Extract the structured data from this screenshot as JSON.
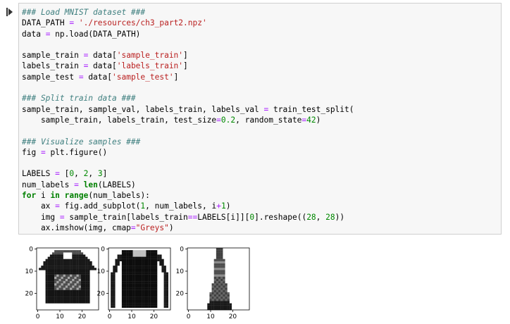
{
  "cell": {
    "code_lines": [
      [
        {
          "t": "### Load MNIST dataset ###",
          "c": "comment"
        }
      ],
      [
        {
          "t": "DATA_PATH ",
          "c": "plain"
        },
        {
          "t": "=",
          "c": "op"
        },
        {
          "t": " ",
          "c": "plain"
        },
        {
          "t": "'./resources/ch3_part2.npz'",
          "c": "string"
        }
      ],
      [
        {
          "t": "data ",
          "c": "plain"
        },
        {
          "t": "=",
          "c": "op"
        },
        {
          "t": " np.load(DATA_PATH)",
          "c": "plain"
        }
      ],
      [],
      [
        {
          "t": "sample_train ",
          "c": "plain"
        },
        {
          "t": "=",
          "c": "op"
        },
        {
          "t": " data[",
          "c": "plain"
        },
        {
          "t": "'sample_train'",
          "c": "string"
        },
        {
          "t": "]",
          "c": "plain"
        }
      ],
      [
        {
          "t": "labels_train ",
          "c": "plain"
        },
        {
          "t": "=",
          "c": "op"
        },
        {
          "t": " data[",
          "c": "plain"
        },
        {
          "t": "'labels_train'",
          "c": "string"
        },
        {
          "t": "]",
          "c": "plain"
        }
      ],
      [
        {
          "t": "sample_test ",
          "c": "plain"
        },
        {
          "t": "=",
          "c": "op"
        },
        {
          "t": " data[",
          "c": "plain"
        },
        {
          "t": "'sample_test'",
          "c": "string"
        },
        {
          "t": "]",
          "c": "plain"
        }
      ],
      [],
      [
        {
          "t": "### Split train data ###",
          "c": "comment"
        }
      ],
      [
        {
          "t": "sample_train, sample_val, labels_train, labels_val ",
          "c": "plain"
        },
        {
          "t": "=",
          "c": "op"
        },
        {
          "t": " train_test_split(",
          "c": "plain"
        }
      ],
      [
        {
          "t": "    sample_train, labels_train, test_size",
          "c": "plain"
        },
        {
          "t": "=",
          "c": "op"
        },
        {
          "t": "0.2",
          "c": "number"
        },
        {
          "t": ", random_state",
          "c": "plain"
        },
        {
          "t": "=",
          "c": "op"
        },
        {
          "t": "42",
          "c": "number"
        },
        {
          "t": ")",
          "c": "plain"
        }
      ],
      [],
      [
        {
          "t": "### Visualize samples ###",
          "c": "comment"
        }
      ],
      [
        {
          "t": "fig ",
          "c": "plain"
        },
        {
          "t": "=",
          "c": "op"
        },
        {
          "t": " plt.figure()",
          "c": "plain"
        }
      ],
      [],
      [
        {
          "t": "LABELS ",
          "c": "plain"
        },
        {
          "t": "=",
          "c": "op"
        },
        {
          "t": " [",
          "c": "plain"
        },
        {
          "t": "0",
          "c": "number"
        },
        {
          "t": ", ",
          "c": "plain"
        },
        {
          "t": "2",
          "c": "number"
        },
        {
          "t": ", ",
          "c": "plain"
        },
        {
          "t": "3",
          "c": "number"
        },
        {
          "t": "]",
          "c": "plain"
        }
      ],
      [
        {
          "t": "num_labels ",
          "c": "plain"
        },
        {
          "t": "=",
          "c": "op"
        },
        {
          "t": " ",
          "c": "plain"
        },
        {
          "t": "len",
          "c": "keyword"
        },
        {
          "t": "(LABELS)",
          "c": "plain"
        }
      ],
      [
        {
          "t": "for",
          "c": "keyword"
        },
        {
          "t": " i ",
          "c": "plain"
        },
        {
          "t": "in",
          "c": "keyword"
        },
        {
          "t": " ",
          "c": "plain"
        },
        {
          "t": "range",
          "c": "keyword"
        },
        {
          "t": "(num_labels):",
          "c": "plain"
        }
      ],
      [
        {
          "t": "    ax ",
          "c": "plain"
        },
        {
          "t": "=",
          "c": "op"
        },
        {
          "t": " fig.add_subplot(",
          "c": "plain"
        },
        {
          "t": "1",
          "c": "number"
        },
        {
          "t": ", num_labels, i",
          "c": "plain"
        },
        {
          "t": "+",
          "c": "op"
        },
        {
          "t": "1",
          "c": "number"
        },
        {
          "t": ")",
          "c": "plain"
        }
      ],
      [
        {
          "t": "    img ",
          "c": "plain"
        },
        {
          "t": "=",
          "c": "op"
        },
        {
          "t": " sample_train[labels_train",
          "c": "plain"
        },
        {
          "t": "==",
          "c": "op"
        },
        {
          "t": "LABELS[i]][",
          "c": "plain"
        },
        {
          "t": "0",
          "c": "number"
        },
        {
          "t": "].reshape((",
          "c": "plain"
        },
        {
          "t": "28",
          "c": "number"
        },
        {
          "t": ", ",
          "c": "plain"
        },
        {
          "t": "28",
          "c": "number"
        },
        {
          "t": "))",
          "c": "plain"
        }
      ],
      [
        {
          "t": "    ax.imshow(img, cmap",
          "c": "plain"
        },
        {
          "t": "=",
          "c": "op"
        },
        {
          "t": "\"Greys\"",
          "c": "string"
        },
        {
          "t": ")",
          "c": "plain"
        }
      ]
    ]
  },
  "colors": {
    "comment": "#408080",
    "string": "#ba2121",
    "keyword": "#008000",
    "number": "#008800",
    "op": "#aa22ff",
    "cell_background": "#f7f7f7",
    "cell_border": "#cfcfcf"
  },
  "output": {
    "panels": [
      {
        "label_value": 0,
        "garment": "t-shirt",
        "x_ticks": [
          "0",
          "10",
          "20"
        ],
        "y_ticks": [
          "0",
          "10",
          "20"
        ]
      },
      {
        "label_value": 2,
        "garment": "long-sleeve-top",
        "x_ticks": [
          "0",
          "10",
          "20"
        ],
        "y_ticks": [
          "0",
          "10",
          "20"
        ]
      },
      {
        "label_value": 3,
        "garment": "dress",
        "x_ticks": [
          "0",
          "10",
          "20"
        ],
        "y_ticks": [
          "0",
          "10",
          "20"
        ]
      }
    ]
  }
}
